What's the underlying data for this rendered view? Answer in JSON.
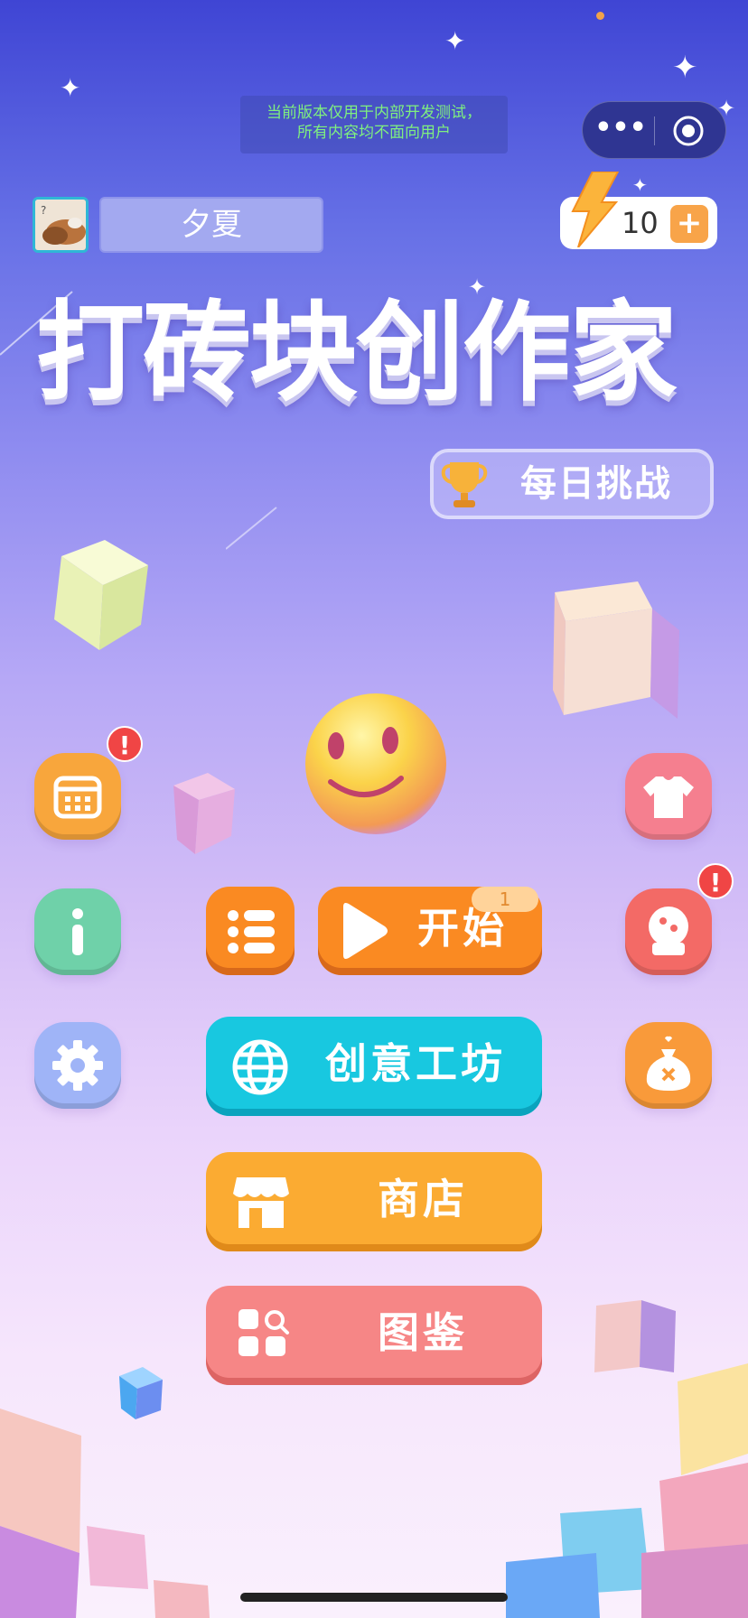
{
  "dev_notice": {
    "line1": "当前版本仅用于内部开发测试，",
    "line2": "所有内容均不面向用户"
  },
  "capsule": {
    "more_icon": "more-dots-icon",
    "close_icon": "target-circle-icon"
  },
  "user": {
    "name": "夕夏",
    "avatar_icon": "user-avatar"
  },
  "energy": {
    "value": "10",
    "add_label": "+",
    "icon": "lightning-bolt-icon"
  },
  "game_title": "打砖块创作家",
  "daily_challenge": {
    "label": "每日挑战",
    "icon": "trophy-icon"
  },
  "side_buttons": {
    "calendar": {
      "icon": "calendar-icon",
      "color": "#f8a63c",
      "badge": "!"
    },
    "info": {
      "icon": "info-icon",
      "color": "#6fd1a9"
    },
    "settings": {
      "icon": "gear-icon",
      "color": "#9fb4f7"
    },
    "skin": {
      "icon": "tshirt-icon",
      "color": "#f57f8f"
    },
    "gacha": {
      "icon": "capsule-machine-icon",
      "color": "#f36a66",
      "badge": "!"
    },
    "lucky_bag": {
      "icon": "lucky-bag-icon",
      "color": "#f99a3a"
    }
  },
  "main_buttons": {
    "list": {
      "icon": "list-icon",
      "color": "#fa8a22"
    },
    "start": {
      "label": "开始",
      "icon": "play-icon",
      "color": "#fa8a22",
      "badge": "1"
    },
    "workshop": {
      "label": "创意工坊",
      "icon": "globe-icon",
      "color": "#18c8e0"
    },
    "shop": {
      "label": "商店",
      "icon": "store-icon",
      "color": "#fbab32"
    },
    "gallery": {
      "label": "图鉴",
      "icon": "gallery-search-icon",
      "color": "#f68686"
    }
  }
}
